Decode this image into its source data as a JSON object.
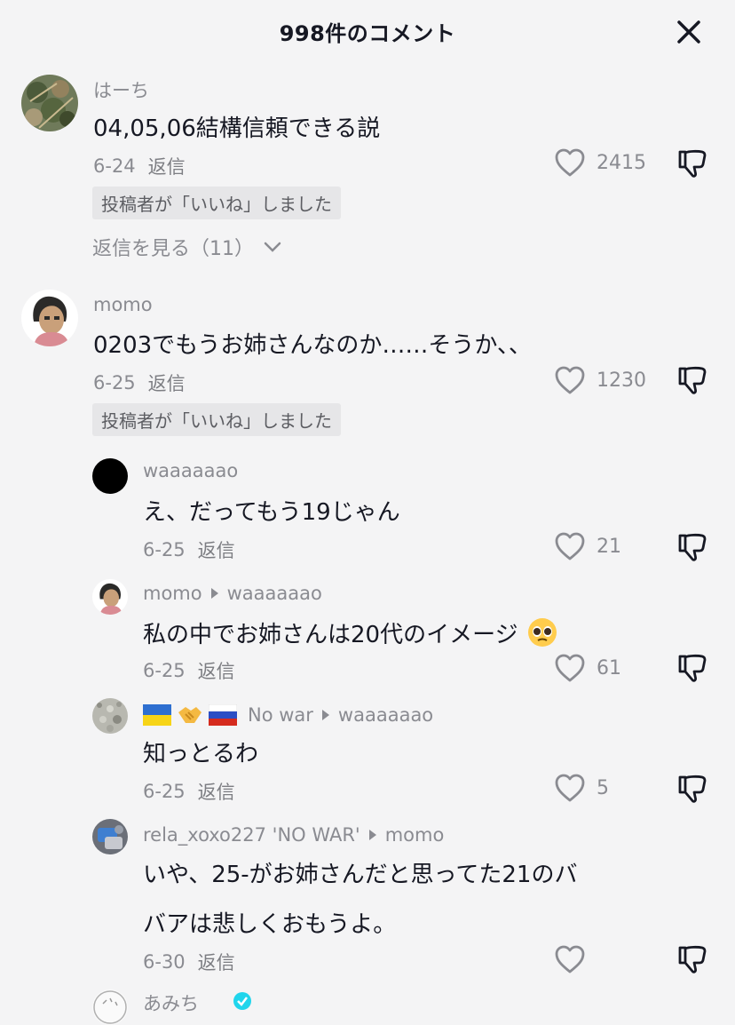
{
  "header": {
    "title": "998件のコメント"
  },
  "comments": [
    {
      "user": "はーち",
      "text": "04,05,06結構信頼できる説",
      "date": "6-24",
      "reply_label": "返信",
      "likes": "2415",
      "badge": "投稿者が「いいね」しました",
      "view_replies": "返信を見る（11）"
    },
    {
      "user": "momo",
      "text": "0203でもうお姉さんなのか……そうか、、",
      "date": "6-25",
      "reply_label": "返信",
      "likes": "1230",
      "badge": "投稿者が「いいね」しました"
    }
  ],
  "replies": [
    {
      "user": "waaaaaao",
      "text": "え、だってもう19じゃん",
      "date": "6-25",
      "reply_label": "返信",
      "likes": "21"
    },
    {
      "user": "momo",
      "reply_to": "waaaaaao",
      "text": "私の中でお姉さんは20代のイメージ",
      "date": "6-25",
      "reply_label": "返信",
      "likes": "61"
    },
    {
      "user": "No war",
      "reply_to": "waaaaaao",
      "text": "知っとるわ",
      "date": "6-25",
      "reply_label": "返信",
      "likes": "5"
    },
    {
      "user": "rela_xoxo227 'NO WAR'",
      "reply_to": "momo",
      "text_line1": "いや、25-がお姉さんだと思ってた21のバ",
      "text_line2": "バアは悲しくおもうよ。",
      "date": "6-30",
      "reply_label": "返信",
      "likes": ""
    },
    {
      "user": "あみち"
    }
  ],
  "colors": {
    "background": "#f4f4f5",
    "text": "#161823",
    "secondary": "#8a8b91",
    "badge_bg": "#e6e6e8",
    "verified": "#20d5ec"
  }
}
